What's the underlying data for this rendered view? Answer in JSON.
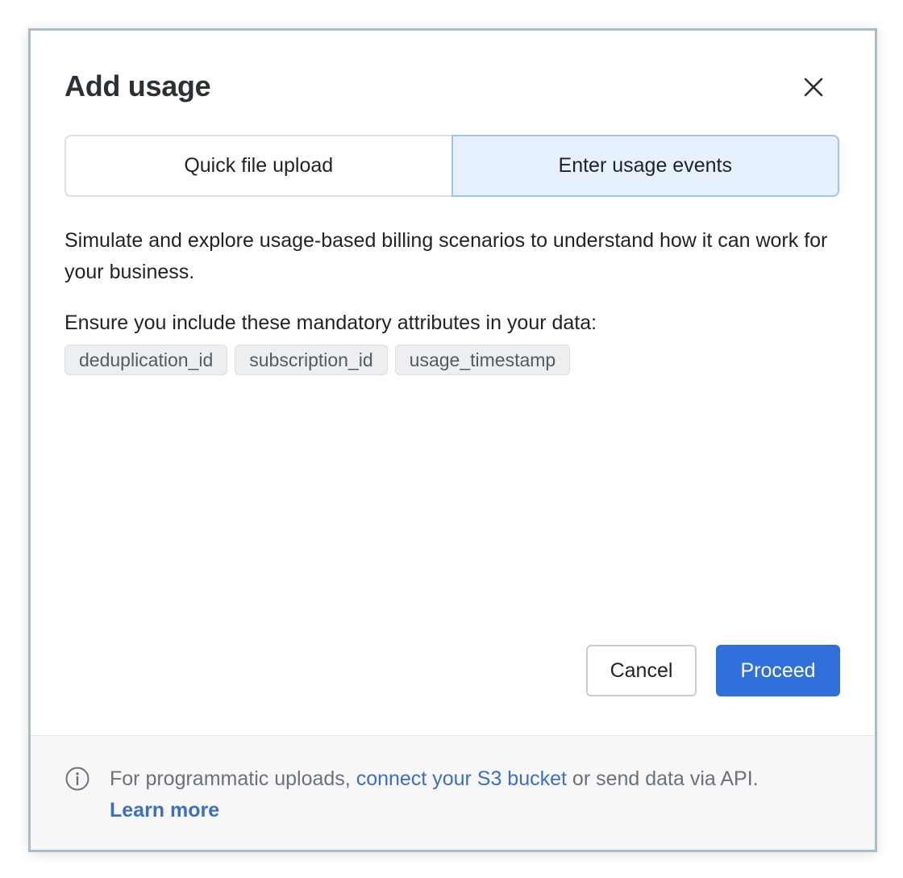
{
  "dialog": {
    "title": "Add usage",
    "close_icon": "close-icon"
  },
  "tabs": [
    {
      "label": "Quick file upload",
      "selected": false
    },
    {
      "label": "Enter usage events",
      "selected": true
    }
  ],
  "description": "Simulate and explore usage-based billing scenarios to understand how it can work for your business.",
  "attributes": {
    "label": "Ensure you include these mandatory attributes in your data:",
    "items": [
      "deduplication_id",
      "subscription_id",
      "usage_timestamp"
    ]
  },
  "actions": {
    "cancel_label": "Cancel",
    "proceed_label": "Proceed"
  },
  "footer": {
    "icon": "info-icon",
    "text_before": "For programmatic uploads, ",
    "link_s3": "connect your S3 bucket",
    "text_after": " or send data via API.",
    "learn_more": "Learn more"
  },
  "colors": {
    "primary": "#2f70dc",
    "selected_tab_bg": "#e7f1fd",
    "link": "#3b6fc4"
  }
}
